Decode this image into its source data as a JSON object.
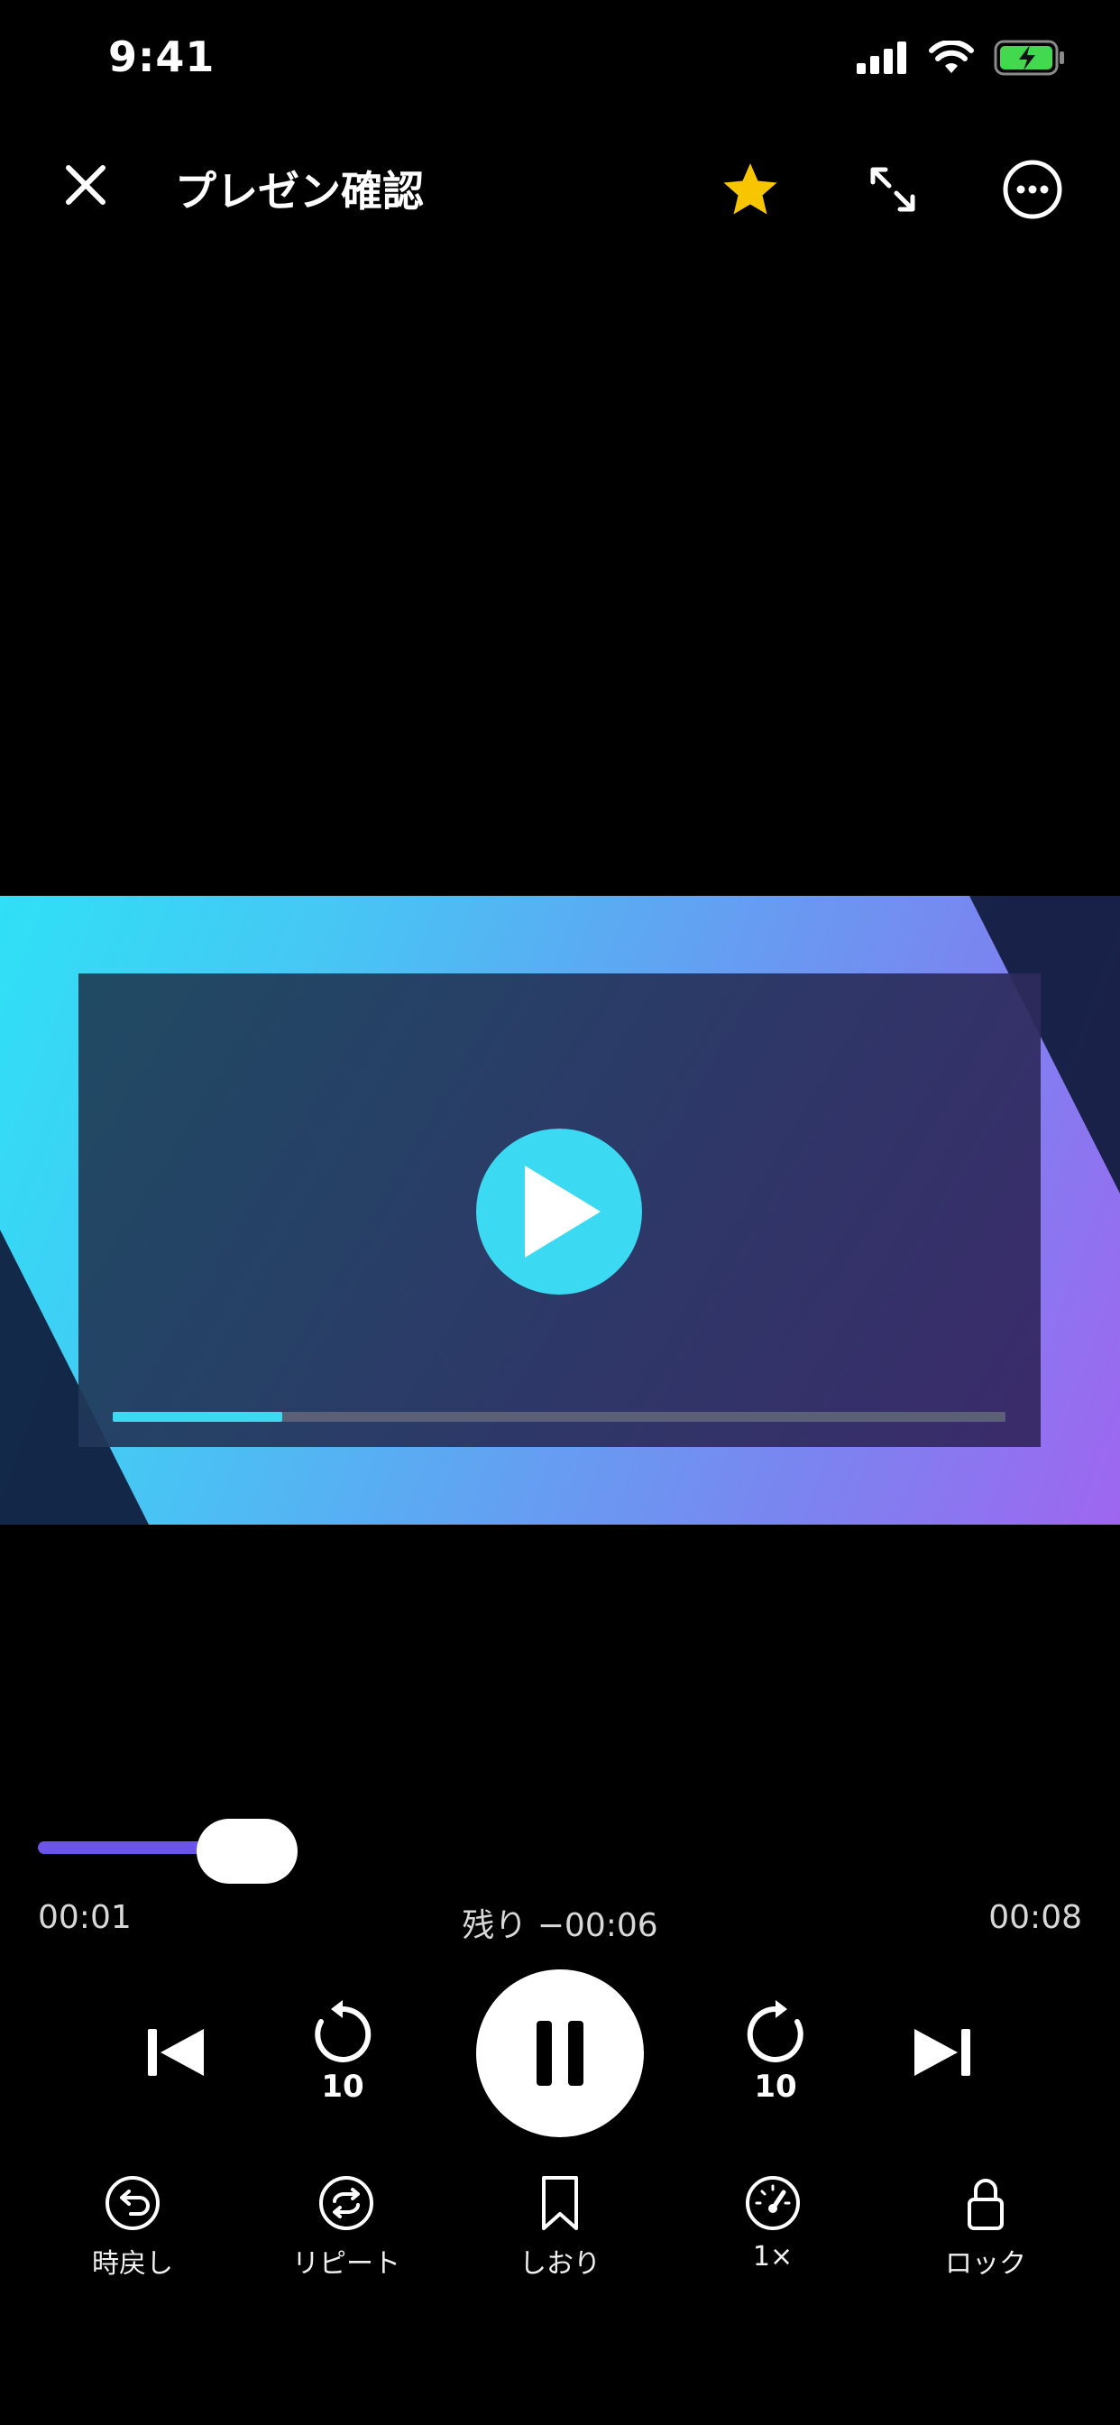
{
  "status": {
    "time": "9:41",
    "battery_color": "#43d94e"
  },
  "header": {
    "title": "プレゼン確認",
    "star_color": "#f7c600"
  },
  "video": {
    "progress_fraction": 0.19,
    "accent": "#3bdaf2"
  },
  "scrubber": {
    "progress_fraction": 0.2,
    "elapsed": "00:01",
    "remaining": "残り −00:06",
    "total": "00:08",
    "fill_color": "#6a55e8"
  },
  "transport": {
    "rewind_label": "10",
    "forward_label": "10"
  },
  "toolbar": {
    "items": [
      {
        "label": "時戻し",
        "icon": "back-in-time-icon"
      },
      {
        "label": "リピート",
        "icon": "repeat-icon"
      },
      {
        "label": "しおり",
        "icon": "bookmark-icon"
      },
      {
        "label": "1×",
        "icon": "speed-gauge-icon"
      },
      {
        "label": "ロック",
        "icon": "lock-icon"
      }
    ]
  }
}
